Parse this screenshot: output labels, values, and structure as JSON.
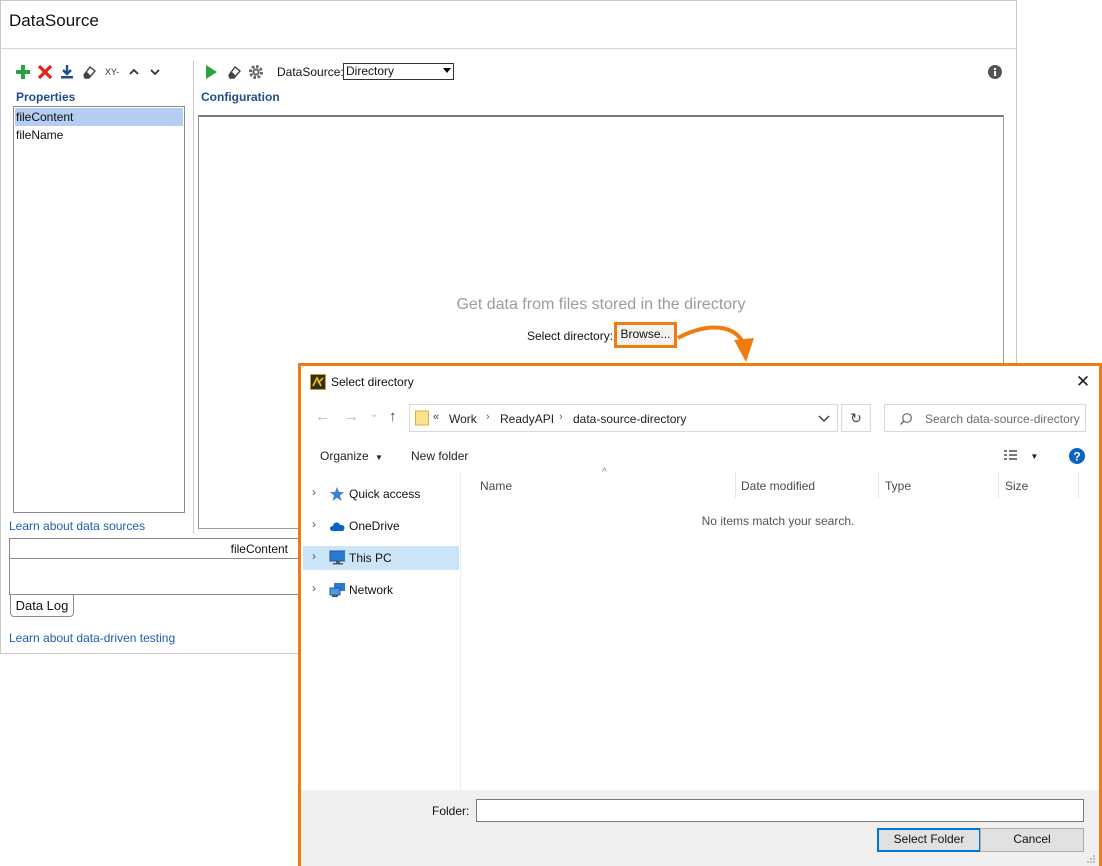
{
  "datasource_panel": {
    "title": "DataSource",
    "properties_label": "Properties",
    "properties": [
      "fileContent",
      "fileName"
    ],
    "toolbar_xy_label": "XY-",
    "configuration_label": "Configuration",
    "datasource_field_label": "DataSource:",
    "datasource_selected": "Directory",
    "hint_text": "Get data from files stored in the directory",
    "select_directory_label": "Select directory:",
    "browse_label": "Browse...",
    "learn_data_sources": "Learn about data sources",
    "log_column_header": "fileContent",
    "data_log_tab": "Data Log",
    "learn_data_driven": "Learn about data-driven testing",
    "colors": {
      "accent_orange": "#f07c0f",
      "section_blue": "#1f4e8a",
      "link_blue": "#1a5fb4",
      "selection": "#b4cdf0"
    }
  },
  "dialog": {
    "title": "Select directory",
    "breadcrumb": [
      "Work",
      "ReadyAPI",
      "data-source-directory"
    ],
    "breadcrumb_prefix": "«",
    "search_placeholder": "Search data-source-directory",
    "organize_label": "Organize",
    "new_folder_label": "New folder",
    "nav_items": [
      {
        "label": "Quick access",
        "icon": "star-icon"
      },
      {
        "label": "OneDrive",
        "icon": "cloud-icon"
      },
      {
        "label": "This PC",
        "icon": "monitor-icon",
        "selected": true
      },
      {
        "label": "Network",
        "icon": "network-icon"
      }
    ],
    "columns": [
      "Name",
      "Date modified",
      "Type",
      "Size"
    ],
    "empty_message": "No items match your search.",
    "folder_label": "Folder:",
    "folder_value": "",
    "select_folder_label": "Select Folder",
    "cancel_label": "Cancel"
  }
}
